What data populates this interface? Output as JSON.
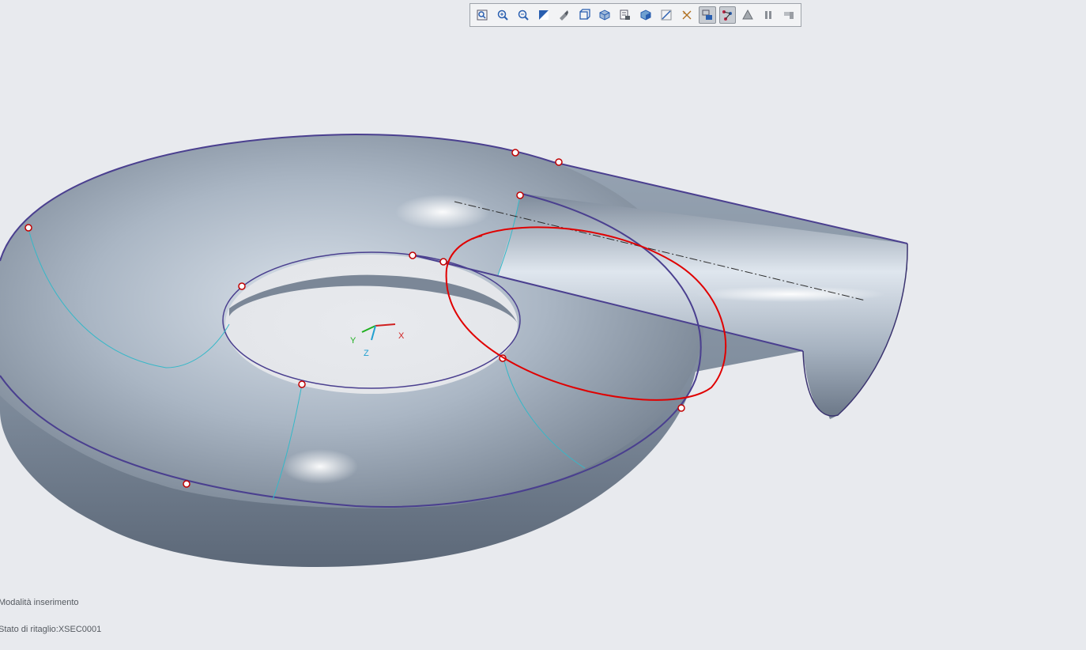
{
  "toolbar": {
    "buttons": [
      {
        "name": "refit-icon",
        "active": false
      },
      {
        "name": "zoom-in-icon",
        "active": false
      },
      {
        "name": "zoom-out-icon",
        "active": false
      },
      {
        "name": "repaint-icon",
        "active": false
      },
      {
        "name": "reorient-icon",
        "active": false
      },
      {
        "name": "saved-orientations-icon",
        "active": false
      },
      {
        "name": "display-style-icon",
        "active": false
      },
      {
        "name": "view-manager-icon",
        "active": false
      },
      {
        "name": "perspective-view-icon",
        "active": false
      },
      {
        "name": "annotation-display-icon",
        "active": false
      },
      {
        "name": "datum-display-icon",
        "active": false
      },
      {
        "name": "section-display-icon",
        "active": true
      },
      {
        "name": "cross-section-icon",
        "active": true
      },
      {
        "name": "appearance-icon",
        "active": false
      },
      {
        "name": "pause-icon",
        "active": false
      },
      {
        "name": "spin-center-icon",
        "active": false
      }
    ]
  },
  "axes": {
    "x": "X",
    "y": "Y",
    "z": "Z"
  },
  "status": {
    "mode": "Modalità inserimento",
    "clip": "Stato di ritaglio:XSEC0001"
  },
  "colors": {
    "background": "#e8eaee",
    "surface": "#a8b4c2",
    "edge": "#4a3f8f",
    "markup": "#e00000"
  }
}
